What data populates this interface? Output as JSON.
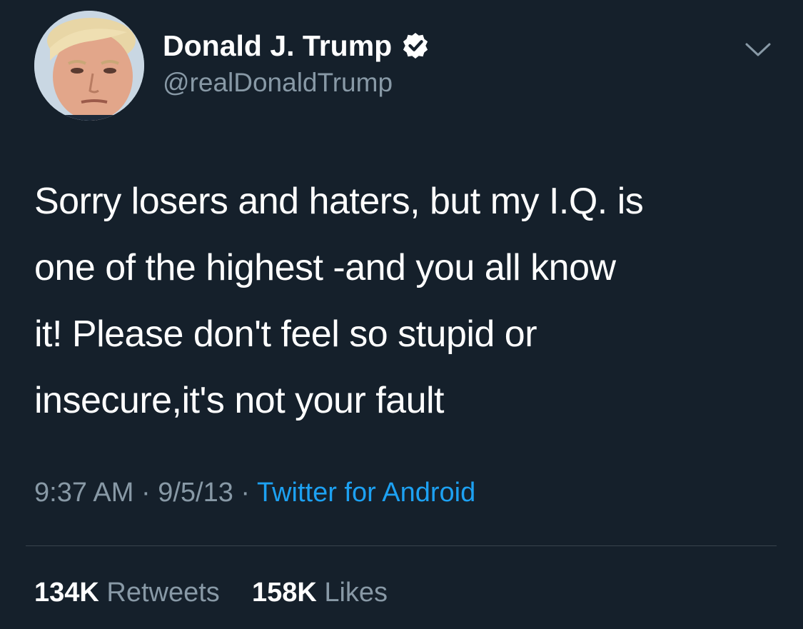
{
  "author": {
    "display_name": "Donald J. Trump",
    "handle": "@realDonaldTrump",
    "verified": true,
    "avatar_icon": "profile-photo"
  },
  "tweet": {
    "lines": [
      "Sorry losers and haters, but my I.Q. is",
      "one of the highest -and you all know",
      "it! Please don't feel so stupid or",
      "insecure,it's not your fault"
    ],
    "time": "9:37 AM",
    "date": "9/5/13",
    "separator": "·",
    "source": "Twitter for Android"
  },
  "stats": {
    "retweets_count": "134K",
    "retweets_label": "Retweets",
    "likes_count": "158K",
    "likes_label": "Likes"
  },
  "colors": {
    "background": "#15202b",
    "primary_text": "#ffffff",
    "secondary_text": "#8899a6",
    "link": "#1da1f2",
    "divider": "#38444d"
  },
  "icons": {
    "verified": "verified-badge-icon",
    "menu": "chevron-down-icon"
  }
}
